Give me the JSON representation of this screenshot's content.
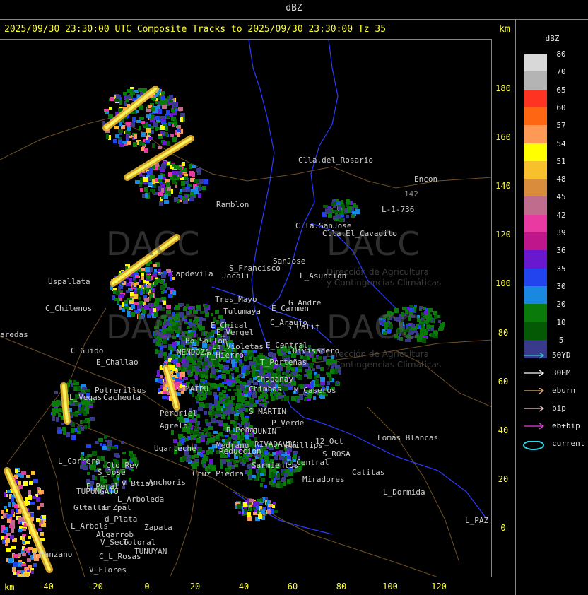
{
  "header": {
    "title": "dBZ",
    "subtitle": "2025/09/30 23:30:00 UTC Composite Tracks to 2025/09/30 23:30:00 Tz 35",
    "km_top": "km",
    "km_bottom": "km"
  },
  "axes": {
    "y_ticks": [
      "180",
      "160",
      "140",
      "120",
      "100",
      "80",
      "60",
      "40",
      "20",
      "0"
    ],
    "x_ticks": [
      "-40",
      "-20",
      "0",
      "20",
      "40",
      "60",
      "80",
      "100",
      "120"
    ]
  },
  "legend": {
    "title": "dBZ",
    "scale": [
      {
        "label": "80",
        "color": "#d8d8d8"
      },
      {
        "label": "70",
        "color": "#b4b4b4"
      },
      {
        "label": "65",
        "color": "#ff3322"
      },
      {
        "label": "60",
        "color": "#ff6611"
      },
      {
        "label": "57",
        "color": "#ff9955"
      },
      {
        "label": "54",
        "color": "#ffff00"
      },
      {
        "label": "51",
        "color": "#f9c02e"
      },
      {
        "label": "48",
        "color": "#d98c3c"
      },
      {
        "label": "45",
        "color": "#c06c8c"
      },
      {
        "label": "42",
        "color": "#e83aa0"
      },
      {
        "label": "39",
        "color": "#c0168c"
      },
      {
        "label": "36",
        "color": "#6a18d0"
      },
      {
        "label": "35",
        "color": "#2244ee"
      },
      {
        "label": "30",
        "color": "#1888e0"
      },
      {
        "label": "20",
        "color": "#0a7a0a"
      },
      {
        "label": "10",
        "color": "#045a04"
      },
      {
        "label": "5",
        "color": "#3a3a8c"
      }
    ],
    "tracks": [
      {
        "label": "50YD",
        "color": "#33c8c8"
      },
      {
        "label": "30HM",
        "color": "#ffffff"
      },
      {
        "label": "eburn",
        "color": "#e6b070"
      },
      {
        "label": "bip",
        "color": "#f0c8c8"
      },
      {
        "label": "eb+bip",
        "color": "#e040e0"
      },
      {
        "label": "current",
        "color": "#33d6e6"
      }
    ]
  },
  "watermarks": {
    "brand": "DACC",
    "subtext_1": "Dirección de Agricultura",
    "subtext_2": "y Contingencias Climáticas"
  },
  "places": [
    {
      "name": "Clla.del_Rosario"
    },
    {
      "name": "Encon"
    },
    {
      "name": "L-1-736"
    },
    {
      "name": "142"
    },
    {
      "name": "Ramblon"
    },
    {
      "name": "Clla.SanJose"
    },
    {
      "name": "Clla.El_Cavadito"
    },
    {
      "name": "Uspallata"
    },
    {
      "name": "Capdevila"
    },
    {
      "name": "S_Francisco"
    },
    {
      "name": "Jocoli"
    },
    {
      "name": "SanJose"
    },
    {
      "name": "L_Asuncion"
    },
    {
      "name": "Tres_Mayo"
    },
    {
      "name": "Tulumaya"
    },
    {
      "name": "E_Carmen"
    },
    {
      "name": "G_Andre"
    },
    {
      "name": "C_Chilenos"
    },
    {
      "name": "E_Chical"
    },
    {
      "name": "E_Vergel"
    },
    {
      "name": "C_Araujo"
    },
    {
      "name": "S_Calif"
    },
    {
      "name": "aredas"
    },
    {
      "name": "E_Central"
    },
    {
      "name": "Divisadero"
    },
    {
      "name": "C_Guido"
    },
    {
      "name": "Bo_Sollon"
    },
    {
      "name": "Ls_Violetas"
    },
    {
      "name": "P_Hierro"
    },
    {
      "name": "E_Challao"
    },
    {
      "name": "MENDOZA"
    },
    {
      "name": "T_Porteñas"
    },
    {
      "name": "Chapanay"
    },
    {
      "name": "Potrerillos"
    },
    {
      "name": "L_Vegas"
    },
    {
      "name": "Cacheuta"
    },
    {
      "name": "MAIPU"
    },
    {
      "name": "Chimbas"
    },
    {
      "name": "M_Caseros"
    },
    {
      "name": "Perdriel"
    },
    {
      "name": "S_MARTIN"
    },
    {
      "name": "P_Verde"
    },
    {
      "name": "Agrelo"
    },
    {
      "name": "R_Peña"
    },
    {
      "name": "JUNIN"
    },
    {
      "name": "Medrano"
    },
    {
      "name": "RIVADAVIA"
    },
    {
      "name": "Phillips"
    },
    {
      "name": "12_Oct"
    },
    {
      "name": "S_ROSA"
    },
    {
      "name": "Lomas_Blancas"
    },
    {
      "name": "Ugarteche"
    },
    {
      "name": "Reduccion"
    },
    {
      "name": "Sarmientos"
    },
    {
      "name": "L_Central"
    },
    {
      "name": "L_Carrera"
    },
    {
      "name": "Cto_Rey"
    },
    {
      "name": "S_Jose"
    },
    {
      "name": "Anchoris"
    },
    {
      "name": "Cruz_Piedra"
    },
    {
      "name": "Miradores"
    },
    {
      "name": "Catitas"
    },
    {
      "name": "E_Peral"
    },
    {
      "name": "V_Btias"
    },
    {
      "name": "TUPUNGATO"
    },
    {
      "name": "L_Arboleda"
    },
    {
      "name": "L_Dormida"
    },
    {
      "name": "Gltallar"
    },
    {
      "name": "E_Zpal"
    },
    {
      "name": "d_Plata"
    },
    {
      "name": "L_Arbols"
    },
    {
      "name": "Zapata"
    },
    {
      "name": "Algarrob"
    },
    {
      "name": "V_Seco"
    },
    {
      "name": "Totoral"
    },
    {
      "name": "TUNUYAN"
    },
    {
      "name": "C_L_Rosas"
    },
    {
      "name": "Manzano"
    },
    {
      "name": "V_Flores"
    },
    {
      "name": "L_PAZ"
    }
  ]
}
